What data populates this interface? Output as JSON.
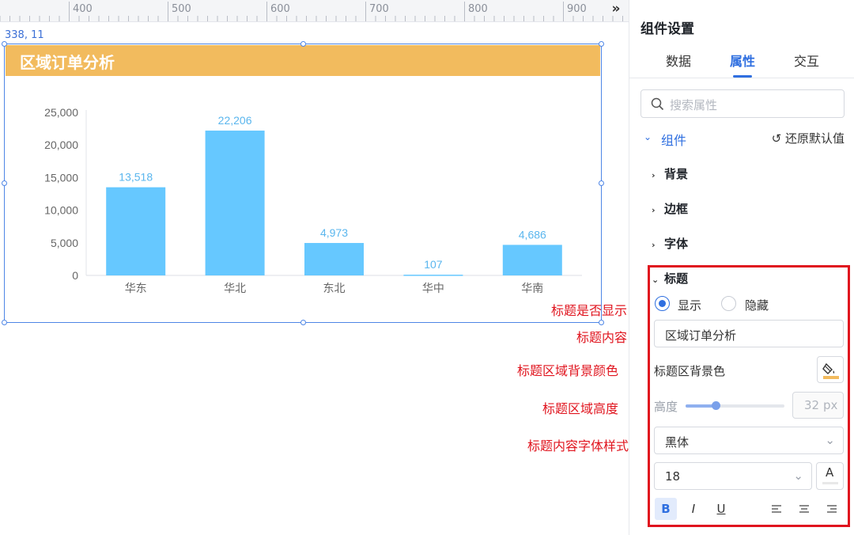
{
  "ruler": {
    "labels": [
      "400",
      "500",
      "600",
      "700",
      "800",
      "900"
    ],
    "more_icon": "double-chevron-right-icon"
  },
  "coords": "338, 11",
  "widget": {
    "title": "区域订单分析"
  },
  "chart_data": {
    "type": "bar",
    "categories": [
      "华东",
      "华北",
      "东北",
      "华中",
      "华南"
    ],
    "values": [
      13518,
      22206,
      4973,
      107,
      4686
    ],
    "value_labels": [
      "13,518",
      "22,206",
      "4,973",
      "107",
      "4,686"
    ],
    "yticks": [
      "0",
      "5,000",
      "10,000",
      "15,000",
      "20,000",
      "25,000"
    ],
    "ylim": [
      0,
      25000
    ],
    "bar_color": "#66c8ff",
    "label_color": "#5ab6ee",
    "grid": false
  },
  "annotations": {
    "show": "标题是否显示",
    "content": "标题内容",
    "bg": "标题区域背景颜色",
    "height": "标题区域高度",
    "font": "标题内容字体样式"
  },
  "panel": {
    "title": "组件设置",
    "tabs": [
      "数据",
      "属性",
      "交互"
    ],
    "active_tab": "属性",
    "search_placeholder": "搜索属性",
    "group_label": "组件",
    "reset_label": "还原默认值",
    "sections": [
      "背景",
      "边框",
      "字体",
      "标题"
    ],
    "title_section": {
      "show_label": "显示",
      "hide_label": "隐藏",
      "content_value": "区域订单分析",
      "bg_color_label": "标题区背景色",
      "bg_color": "#f2bb5e",
      "height_label": "高度",
      "height_value": "32",
      "height_unit": "px",
      "height_level": 0.3,
      "font_family": "黑体",
      "font_size": "18",
      "font_color_icon": "A",
      "bold": "B",
      "italic": "I",
      "underline": "U"
    }
  }
}
